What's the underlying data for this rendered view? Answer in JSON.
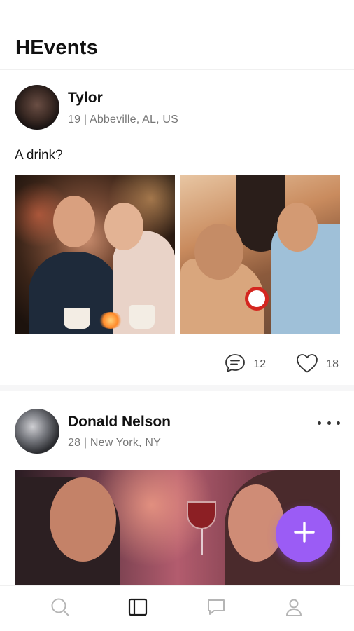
{
  "header": {
    "title": "HEvents"
  },
  "posts": [
    {
      "username": "Tylor",
      "meta": "19 | Abbeville, AL, US",
      "caption": "A drink?",
      "comments_count": "12",
      "likes_count": "18",
      "avatar_icon": "user-avatar-photo",
      "photos": [
        "couple-cafe-photo",
        "group-lying-photo"
      ]
    },
    {
      "username": "Donald Nelson",
      "meta": "28 | New York, NY",
      "avatar_icon": "user-avatar-photo",
      "more_icon": "more-horizontal-icon",
      "photos": [
        "couple-wine-photo"
      ]
    }
  ],
  "fab": {
    "icon": "plus-icon",
    "color": "#9b5cf5"
  },
  "bottom_nav": {
    "items": [
      {
        "icon": "search-icon",
        "active": false
      },
      {
        "icon": "feed-icon",
        "active": true
      },
      {
        "icon": "chat-icon",
        "active": false
      },
      {
        "icon": "profile-icon",
        "active": false
      }
    ],
    "active_color": "#1a1a1a",
    "inactive_color": "#b5b5b5"
  }
}
